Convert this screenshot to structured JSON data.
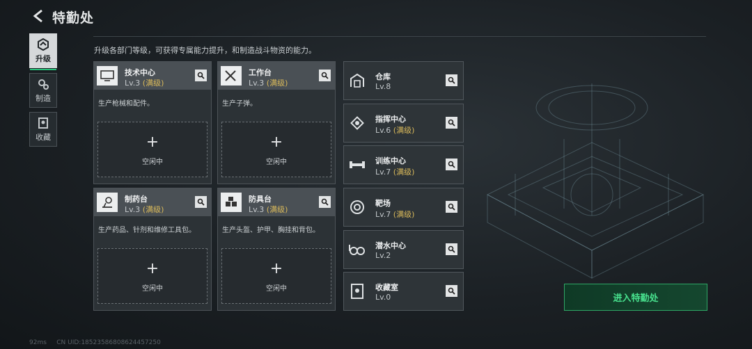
{
  "header": {
    "title": "特勤处"
  },
  "description": "升级各部门等级，可获得专属能力提升，和制造战斗物资的能力。",
  "nav": [
    {
      "label": "升级",
      "icon": "upgrade-icon",
      "active": true
    },
    {
      "label": "制造",
      "icon": "gears-icon",
      "active": false
    },
    {
      "label": "收藏",
      "icon": "collection-icon",
      "active": false
    }
  ],
  "workshops": [
    {
      "name": "技术中心",
      "level": "Lv.3",
      "max": "(满级)",
      "icon": "computer-icon",
      "desc": "生产枪械和配件。",
      "slot_plus": "+",
      "slot_label": "空闲中"
    },
    {
      "name": "工作台",
      "level": "Lv.3",
      "max": "(满级)",
      "icon": "tools-icon",
      "desc": "生产子弹。",
      "slot_plus": "+",
      "slot_label": "空闲中"
    },
    {
      "name": "制药台",
      "level": "Lv.3",
      "max": "(满级)",
      "icon": "microscope-icon",
      "desc": "生产药品、针剂和维修工具包。",
      "slot_plus": "+",
      "slot_label": "空闲中"
    },
    {
      "name": "防具台",
      "level": "Lv.3",
      "max": "(满级)",
      "icon": "armor-blocks-icon",
      "desc": "生产头盔、护甲、胸挂和背包。",
      "slot_plus": "+",
      "slot_label": "空闲中"
    }
  ],
  "facilities": [
    {
      "name": "仓库",
      "level": "Lv.8",
      "max": "",
      "icon": "warehouse-icon"
    },
    {
      "name": "指挥中心",
      "level": "Lv.6",
      "max": "(满级)",
      "icon": "command-chip-icon"
    },
    {
      "name": "训练中心",
      "level": "Lv.7",
      "max": "(满级)",
      "icon": "dumbbell-icon"
    },
    {
      "name": "靶场",
      "level": "Lv.7",
      "max": "(满级)",
      "icon": "target-icon"
    },
    {
      "name": "潜水中心",
      "level": "Lv.2",
      "max": "",
      "icon": "diving-goggles-icon"
    },
    {
      "name": "收藏室",
      "level": "Lv.0",
      "max": "",
      "icon": "trophy-case-icon"
    }
  ],
  "enter_button": "进入特勤处",
  "status": {
    "ping": "92ms",
    "uid": "CN UID:18523586808624457250"
  },
  "colors": {
    "accent": "#27c27a",
    "maxed": "#d9b95a",
    "enter_text": "#48e28e"
  }
}
